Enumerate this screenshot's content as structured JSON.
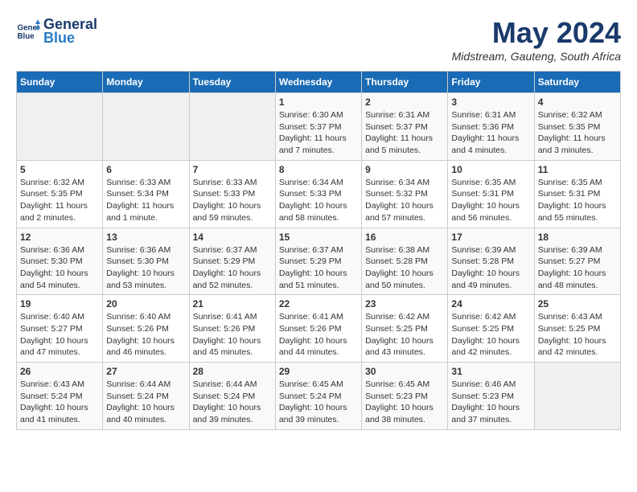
{
  "header": {
    "logo_line1": "General",
    "logo_line2": "Blue",
    "month": "May 2024",
    "location": "Midstream, Gauteng, South Africa"
  },
  "days_of_week": [
    "Sunday",
    "Monday",
    "Tuesday",
    "Wednesday",
    "Thursday",
    "Friday",
    "Saturday"
  ],
  "weeks": [
    [
      {
        "day": "",
        "info": ""
      },
      {
        "day": "",
        "info": ""
      },
      {
        "day": "",
        "info": ""
      },
      {
        "day": "1",
        "info": "Sunrise: 6:30 AM\nSunset: 5:37 PM\nDaylight: 11 hours\nand 7 minutes."
      },
      {
        "day": "2",
        "info": "Sunrise: 6:31 AM\nSunset: 5:37 PM\nDaylight: 11 hours\nand 5 minutes."
      },
      {
        "day": "3",
        "info": "Sunrise: 6:31 AM\nSunset: 5:36 PM\nDaylight: 11 hours\nand 4 minutes."
      },
      {
        "day": "4",
        "info": "Sunrise: 6:32 AM\nSunset: 5:35 PM\nDaylight: 11 hours\nand 3 minutes."
      }
    ],
    [
      {
        "day": "5",
        "info": "Sunrise: 6:32 AM\nSunset: 5:35 PM\nDaylight: 11 hours\nand 2 minutes."
      },
      {
        "day": "6",
        "info": "Sunrise: 6:33 AM\nSunset: 5:34 PM\nDaylight: 11 hours\nand 1 minute."
      },
      {
        "day": "7",
        "info": "Sunrise: 6:33 AM\nSunset: 5:33 PM\nDaylight: 10 hours\nand 59 minutes."
      },
      {
        "day": "8",
        "info": "Sunrise: 6:34 AM\nSunset: 5:33 PM\nDaylight: 10 hours\nand 58 minutes."
      },
      {
        "day": "9",
        "info": "Sunrise: 6:34 AM\nSunset: 5:32 PM\nDaylight: 10 hours\nand 57 minutes."
      },
      {
        "day": "10",
        "info": "Sunrise: 6:35 AM\nSunset: 5:31 PM\nDaylight: 10 hours\nand 56 minutes."
      },
      {
        "day": "11",
        "info": "Sunrise: 6:35 AM\nSunset: 5:31 PM\nDaylight: 10 hours\nand 55 minutes."
      }
    ],
    [
      {
        "day": "12",
        "info": "Sunrise: 6:36 AM\nSunset: 5:30 PM\nDaylight: 10 hours\nand 54 minutes."
      },
      {
        "day": "13",
        "info": "Sunrise: 6:36 AM\nSunset: 5:30 PM\nDaylight: 10 hours\nand 53 minutes."
      },
      {
        "day": "14",
        "info": "Sunrise: 6:37 AM\nSunset: 5:29 PM\nDaylight: 10 hours\nand 52 minutes."
      },
      {
        "day": "15",
        "info": "Sunrise: 6:37 AM\nSunset: 5:29 PM\nDaylight: 10 hours\nand 51 minutes."
      },
      {
        "day": "16",
        "info": "Sunrise: 6:38 AM\nSunset: 5:28 PM\nDaylight: 10 hours\nand 50 minutes."
      },
      {
        "day": "17",
        "info": "Sunrise: 6:39 AM\nSunset: 5:28 PM\nDaylight: 10 hours\nand 49 minutes."
      },
      {
        "day": "18",
        "info": "Sunrise: 6:39 AM\nSunset: 5:27 PM\nDaylight: 10 hours\nand 48 minutes."
      }
    ],
    [
      {
        "day": "19",
        "info": "Sunrise: 6:40 AM\nSunset: 5:27 PM\nDaylight: 10 hours\nand 47 minutes."
      },
      {
        "day": "20",
        "info": "Sunrise: 6:40 AM\nSunset: 5:26 PM\nDaylight: 10 hours\nand 46 minutes."
      },
      {
        "day": "21",
        "info": "Sunrise: 6:41 AM\nSunset: 5:26 PM\nDaylight: 10 hours\nand 45 minutes."
      },
      {
        "day": "22",
        "info": "Sunrise: 6:41 AM\nSunset: 5:26 PM\nDaylight: 10 hours\nand 44 minutes."
      },
      {
        "day": "23",
        "info": "Sunrise: 6:42 AM\nSunset: 5:25 PM\nDaylight: 10 hours\nand 43 minutes."
      },
      {
        "day": "24",
        "info": "Sunrise: 6:42 AM\nSunset: 5:25 PM\nDaylight: 10 hours\nand 42 minutes."
      },
      {
        "day": "25",
        "info": "Sunrise: 6:43 AM\nSunset: 5:25 PM\nDaylight: 10 hours\nand 42 minutes."
      }
    ],
    [
      {
        "day": "26",
        "info": "Sunrise: 6:43 AM\nSunset: 5:24 PM\nDaylight: 10 hours\nand 41 minutes."
      },
      {
        "day": "27",
        "info": "Sunrise: 6:44 AM\nSunset: 5:24 PM\nDaylight: 10 hours\nand 40 minutes."
      },
      {
        "day": "28",
        "info": "Sunrise: 6:44 AM\nSunset: 5:24 PM\nDaylight: 10 hours\nand 39 minutes."
      },
      {
        "day": "29",
        "info": "Sunrise: 6:45 AM\nSunset: 5:24 PM\nDaylight: 10 hours\nand 39 minutes."
      },
      {
        "day": "30",
        "info": "Sunrise: 6:45 AM\nSunset: 5:23 PM\nDaylight: 10 hours\nand 38 minutes."
      },
      {
        "day": "31",
        "info": "Sunrise: 6:46 AM\nSunset: 5:23 PM\nDaylight: 10 hours\nand 37 minutes."
      },
      {
        "day": "",
        "info": ""
      }
    ]
  ]
}
